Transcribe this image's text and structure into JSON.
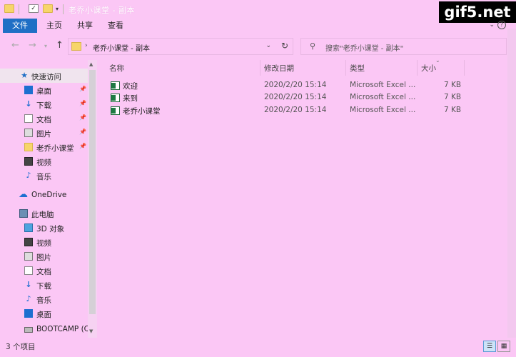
{
  "titlebar": {
    "title": "老乔小课堂 - 副本",
    "watermark": "gif5.net"
  },
  "ribbon": {
    "tabs": [
      "文件",
      "主页",
      "共享",
      "查看"
    ],
    "file_tab_color": "#1f6fc5"
  },
  "address": {
    "path": "老乔小课堂 - 副本",
    "search_placeholder": "搜索\"老乔小课堂 - 副本\""
  },
  "sidebar": {
    "items": [
      {
        "label": "快速访问",
        "icon": "star-icon",
        "pinned": false
      },
      {
        "label": "桌面",
        "icon": "desktop-icon",
        "pinned": true
      },
      {
        "label": "下载",
        "icon": "download-icon",
        "pinned": true
      },
      {
        "label": "文档",
        "icon": "document-icon",
        "pinned": true
      },
      {
        "label": "图片",
        "icon": "picture-icon",
        "pinned": true
      },
      {
        "label": "老乔小课堂",
        "icon": "folder-icon",
        "pinned": true
      },
      {
        "label": "视频",
        "icon": "video-icon",
        "pinned": false
      },
      {
        "label": "音乐",
        "icon": "music-icon",
        "pinned": false
      },
      {
        "label": "OneDrive",
        "icon": "cloud-icon",
        "pinned": false
      },
      {
        "label": "此电脑",
        "icon": "computer-icon",
        "pinned": false
      },
      {
        "label": "3D 对象",
        "icon": "cube-icon",
        "pinned": false
      },
      {
        "label": "视频",
        "icon": "video-icon",
        "pinned": false
      },
      {
        "label": "图片",
        "icon": "picture-icon",
        "pinned": false
      },
      {
        "label": "文档",
        "icon": "document-icon",
        "pinned": false
      },
      {
        "label": "下载",
        "icon": "download-icon",
        "pinned": false
      },
      {
        "label": "音乐",
        "icon": "music-icon",
        "pinned": false
      },
      {
        "label": "桌面",
        "icon": "desktop-icon",
        "pinned": false
      },
      {
        "label": "BOOTCAMP (C",
        "icon": "drive-icon",
        "pinned": false
      }
    ]
  },
  "columns": {
    "name": "名称",
    "date": "修改日期",
    "type": "类型",
    "size": "大小"
  },
  "files": [
    {
      "name": "欢迎",
      "date": "2020/2/20 15:14",
      "type": "Microsoft Excel ...",
      "size": "7 KB"
    },
    {
      "name": "来到",
      "date": "2020/2/20 15:14",
      "type": "Microsoft Excel ...",
      "size": "7 KB"
    },
    {
      "name": "老乔小课堂",
      "date": "2020/2/20 15:14",
      "type": "Microsoft Excel ...",
      "size": "7 KB"
    }
  ],
  "status": {
    "count_text": "3 个项目"
  }
}
